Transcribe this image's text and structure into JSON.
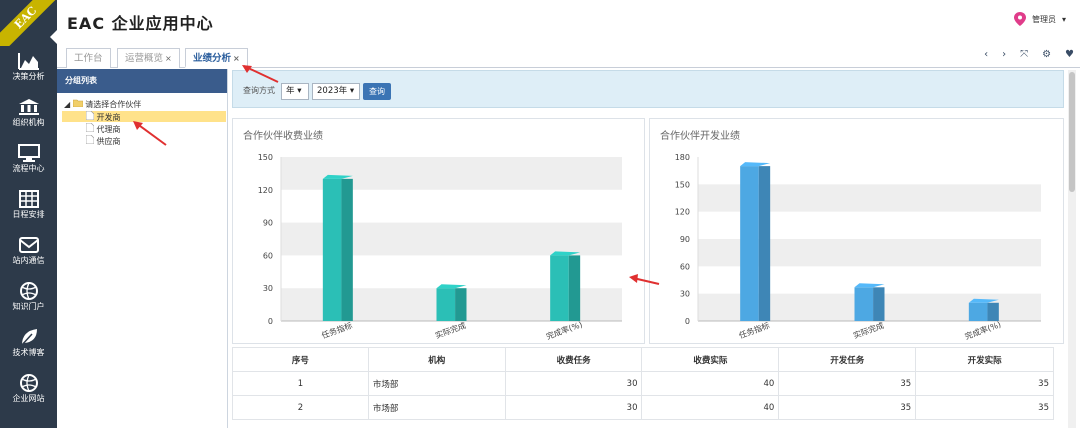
{
  "logo_text": "EAC",
  "app_title": "EAC 企业应用中心",
  "user": {
    "name": "管理员"
  },
  "nav": [
    {
      "label": "决策分析",
      "icon": "area-chart-icon"
    },
    {
      "label": "组织机构",
      "icon": "bank-icon"
    },
    {
      "label": "流程中心",
      "icon": "monitor-icon"
    },
    {
      "label": "日程安排",
      "icon": "table-icon"
    },
    {
      "label": "站内通信",
      "icon": "mail-icon"
    },
    {
      "label": "知识门户",
      "icon": "ball-icon"
    },
    {
      "label": "技术博客",
      "icon": "leaf-icon"
    },
    {
      "label": "企业网站",
      "icon": "ball-icon"
    }
  ],
  "tabs": [
    {
      "label": "工作台",
      "close": ""
    },
    {
      "label": "运营概览",
      "close": "×"
    },
    {
      "label": "业绩分析",
      "close": "×"
    }
  ],
  "tab_tools": [
    "‹",
    "›",
    "⤧",
    "⚙",
    "♥"
  ],
  "tree": {
    "title": "分组列表",
    "root": "请选择合作伙伴",
    "children": [
      "开发商",
      "代理商",
      "供应商"
    ]
  },
  "query": {
    "label": "查询方式",
    "mode": "年",
    "year": "2023年",
    "button": "查询"
  },
  "colors": {
    "teal": "#2bbfb6",
    "blue": "#4da8e3",
    "sidebar": "#2d3a4a"
  },
  "chart_data": [
    {
      "type": "bar",
      "title": "合作伙伴收费业绩",
      "categories": [
        "任务指标",
        "实际完成",
        "完成率(%)"
      ],
      "values": [
        130,
        30,
        60
      ],
      "ylim": [
        0,
        150
      ],
      "yticks": [
        0,
        30,
        60,
        90,
        120,
        150
      ],
      "grid": true
    },
    {
      "type": "bar",
      "title": "合作伙伴开发业绩",
      "categories": [
        "任务指标",
        "实际完成",
        "完成率(%)"
      ],
      "values": [
        170,
        37,
        20
      ],
      "ylim": [
        0,
        180
      ],
      "yticks": [
        0,
        30,
        60,
        90,
        120,
        150,
        180
      ],
      "grid": true
    }
  ],
  "table": {
    "headers": [
      "序号",
      "机构",
      "收费任务",
      "收费实际",
      "开发任务",
      "开发实际"
    ],
    "rows": [
      [
        "1",
        "市场部",
        "30",
        "40",
        "35",
        "35"
      ],
      [
        "2",
        "市场部",
        "30",
        "40",
        "35",
        "35"
      ]
    ]
  }
}
